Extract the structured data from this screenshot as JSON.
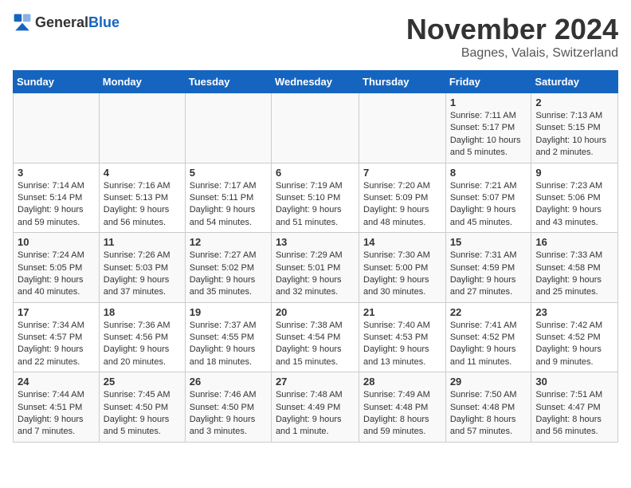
{
  "logo": {
    "text_general": "General",
    "text_blue": "Blue"
  },
  "header": {
    "month_year": "November 2024",
    "location": "Bagnes, Valais, Switzerland"
  },
  "weekdays": [
    "Sunday",
    "Monday",
    "Tuesday",
    "Wednesday",
    "Thursday",
    "Friday",
    "Saturday"
  ],
  "weeks": [
    [
      {
        "day": "",
        "info": ""
      },
      {
        "day": "",
        "info": ""
      },
      {
        "day": "",
        "info": ""
      },
      {
        "day": "",
        "info": ""
      },
      {
        "day": "",
        "info": ""
      },
      {
        "day": "1",
        "info": "Sunrise: 7:11 AM\nSunset: 5:17 PM\nDaylight: 10 hours and 5 minutes."
      },
      {
        "day": "2",
        "info": "Sunrise: 7:13 AM\nSunset: 5:15 PM\nDaylight: 10 hours and 2 minutes."
      }
    ],
    [
      {
        "day": "3",
        "info": "Sunrise: 7:14 AM\nSunset: 5:14 PM\nDaylight: 9 hours and 59 minutes."
      },
      {
        "day": "4",
        "info": "Sunrise: 7:16 AM\nSunset: 5:13 PM\nDaylight: 9 hours and 56 minutes."
      },
      {
        "day": "5",
        "info": "Sunrise: 7:17 AM\nSunset: 5:11 PM\nDaylight: 9 hours and 54 minutes."
      },
      {
        "day": "6",
        "info": "Sunrise: 7:19 AM\nSunset: 5:10 PM\nDaylight: 9 hours and 51 minutes."
      },
      {
        "day": "7",
        "info": "Sunrise: 7:20 AM\nSunset: 5:09 PM\nDaylight: 9 hours and 48 minutes."
      },
      {
        "day": "8",
        "info": "Sunrise: 7:21 AM\nSunset: 5:07 PM\nDaylight: 9 hours and 45 minutes."
      },
      {
        "day": "9",
        "info": "Sunrise: 7:23 AM\nSunset: 5:06 PM\nDaylight: 9 hours and 43 minutes."
      }
    ],
    [
      {
        "day": "10",
        "info": "Sunrise: 7:24 AM\nSunset: 5:05 PM\nDaylight: 9 hours and 40 minutes."
      },
      {
        "day": "11",
        "info": "Sunrise: 7:26 AM\nSunset: 5:03 PM\nDaylight: 9 hours and 37 minutes."
      },
      {
        "day": "12",
        "info": "Sunrise: 7:27 AM\nSunset: 5:02 PM\nDaylight: 9 hours and 35 minutes."
      },
      {
        "day": "13",
        "info": "Sunrise: 7:29 AM\nSunset: 5:01 PM\nDaylight: 9 hours and 32 minutes."
      },
      {
        "day": "14",
        "info": "Sunrise: 7:30 AM\nSunset: 5:00 PM\nDaylight: 9 hours and 30 minutes."
      },
      {
        "day": "15",
        "info": "Sunrise: 7:31 AM\nSunset: 4:59 PM\nDaylight: 9 hours and 27 minutes."
      },
      {
        "day": "16",
        "info": "Sunrise: 7:33 AM\nSunset: 4:58 PM\nDaylight: 9 hours and 25 minutes."
      }
    ],
    [
      {
        "day": "17",
        "info": "Sunrise: 7:34 AM\nSunset: 4:57 PM\nDaylight: 9 hours and 22 minutes."
      },
      {
        "day": "18",
        "info": "Sunrise: 7:36 AM\nSunset: 4:56 PM\nDaylight: 9 hours and 20 minutes."
      },
      {
        "day": "19",
        "info": "Sunrise: 7:37 AM\nSunset: 4:55 PM\nDaylight: 9 hours and 18 minutes."
      },
      {
        "day": "20",
        "info": "Sunrise: 7:38 AM\nSunset: 4:54 PM\nDaylight: 9 hours and 15 minutes."
      },
      {
        "day": "21",
        "info": "Sunrise: 7:40 AM\nSunset: 4:53 PM\nDaylight: 9 hours and 13 minutes."
      },
      {
        "day": "22",
        "info": "Sunrise: 7:41 AM\nSunset: 4:52 PM\nDaylight: 9 hours and 11 minutes."
      },
      {
        "day": "23",
        "info": "Sunrise: 7:42 AM\nSunset: 4:52 PM\nDaylight: 9 hours and 9 minutes."
      }
    ],
    [
      {
        "day": "24",
        "info": "Sunrise: 7:44 AM\nSunset: 4:51 PM\nDaylight: 9 hours and 7 minutes."
      },
      {
        "day": "25",
        "info": "Sunrise: 7:45 AM\nSunset: 4:50 PM\nDaylight: 9 hours and 5 minutes."
      },
      {
        "day": "26",
        "info": "Sunrise: 7:46 AM\nSunset: 4:50 PM\nDaylight: 9 hours and 3 minutes."
      },
      {
        "day": "27",
        "info": "Sunrise: 7:48 AM\nSunset: 4:49 PM\nDaylight: 9 hours and 1 minute."
      },
      {
        "day": "28",
        "info": "Sunrise: 7:49 AM\nSunset: 4:48 PM\nDaylight: 8 hours and 59 minutes."
      },
      {
        "day": "29",
        "info": "Sunrise: 7:50 AM\nSunset: 4:48 PM\nDaylight: 8 hours and 57 minutes."
      },
      {
        "day": "30",
        "info": "Sunrise: 7:51 AM\nSunset: 4:47 PM\nDaylight: 8 hours and 56 minutes."
      }
    ]
  ]
}
